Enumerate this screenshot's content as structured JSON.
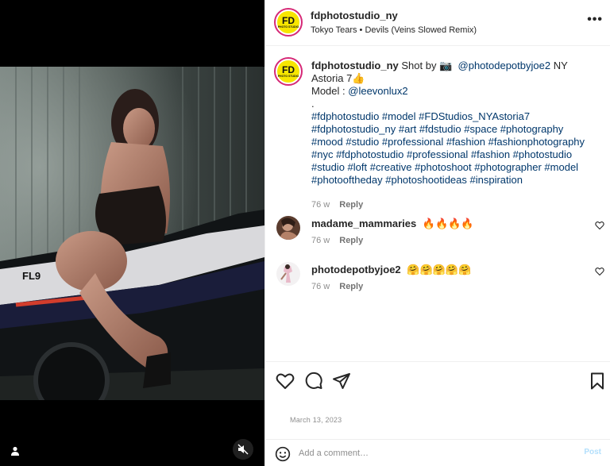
{
  "header": {
    "username": "fdphotostudio_ny",
    "audio": "Tokyo Tears • Devils (Veins Slowed Remix)",
    "more_label": "•••",
    "logo_text": "FD",
    "logo_sub": "PHOTO STUDIO"
  },
  "caption": {
    "username": "fdphotostudio_ny",
    "text_1": "Shot by 📷",
    "mention_1": "@photodepotbyjoe2",
    "text_2": "NY Astoria 7👍",
    "model_label": "Model :",
    "mention_2": "@leevonlux2",
    "dot": ".",
    "hashtags": "#fdphotostudio #model #FDStudios_NYAstoria7 #fdphotostudio_ny #art #fdstudio #space #photography #mood #studio #professional #fashion #fashionphotography #nyc #fdphotostudio #professional #fashion #photostudio #studio #loft #creative #photoshoot #photographer #model #photooftheday #photoshootideas  #inspiration",
    "time": "76 w",
    "reply": "Reply"
  },
  "comments": [
    {
      "username": "madame_mammaries",
      "text": "🔥🔥🔥🔥",
      "time": "76 w",
      "reply": "Reply"
    },
    {
      "username": "photodepotbyjoe2",
      "text": "🤗🤗🤗🤗🤗",
      "time": "76 w",
      "reply": "Reply"
    }
  ],
  "icons": {
    "like": "heart-icon",
    "comment": "comment-icon",
    "share": "send-icon",
    "save": "bookmark-icon",
    "emoji": "emoji-icon",
    "mute": "speaker-muted-icon",
    "user_tag": "user-tag-icon"
  },
  "date": "March 13, 2023",
  "add_comment": {
    "placeholder": "Add a comment…",
    "post_label": "Post"
  },
  "colors": {
    "link": "#00376b",
    "muted": "#8e8e8e",
    "post_disabled": "#b2dffc",
    "story_ring": "#d62976",
    "logo_yellow": "#f7e600"
  }
}
